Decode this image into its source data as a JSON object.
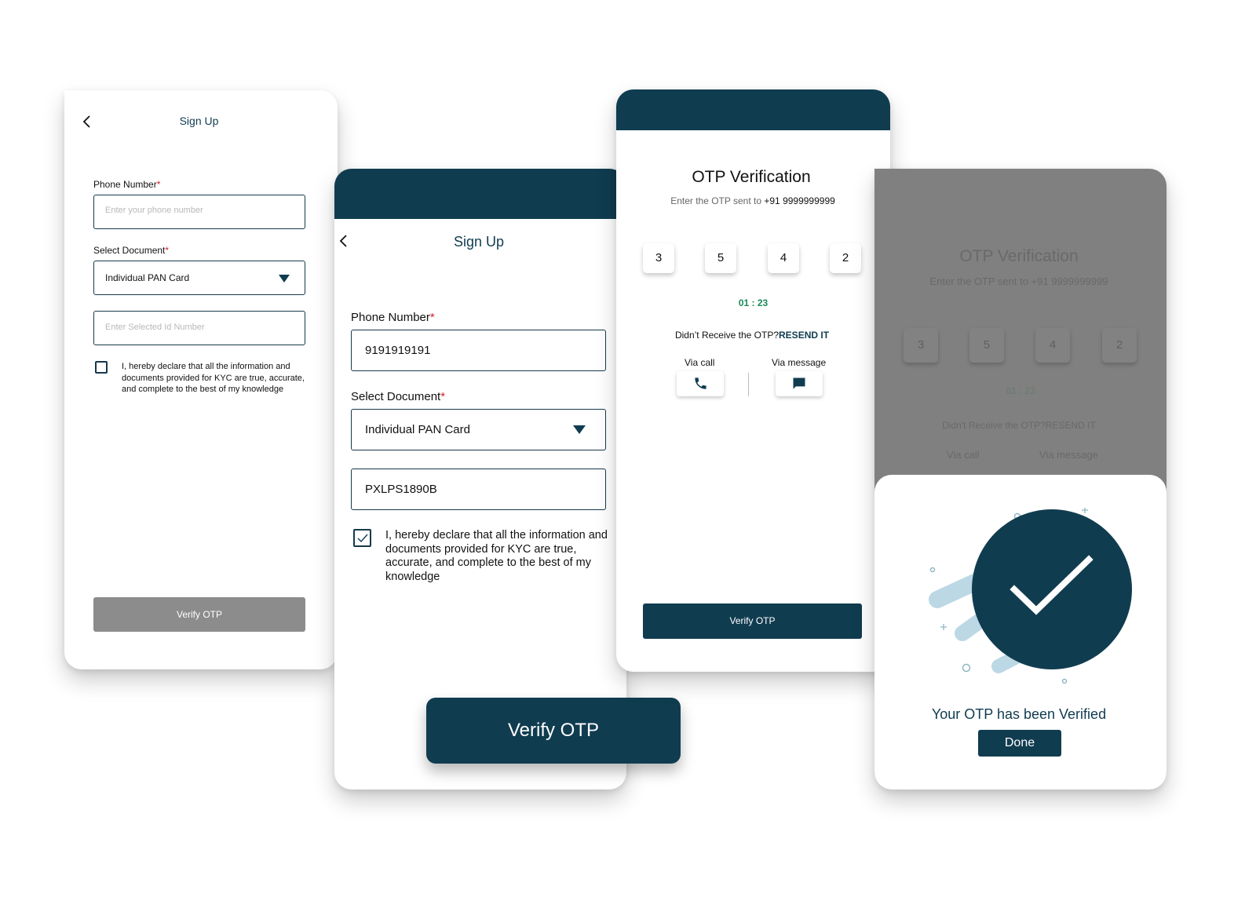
{
  "colors": {
    "primary": "#103c50",
    "disabled": "#8c8c8c",
    "timer": "#1a8a5a",
    "required": "#d21f2b",
    "overlay": "#808080"
  },
  "screen1": {
    "title": "Sign Up",
    "phone_label": "Phone Number",
    "phone_placeholder": "Enter your phone number",
    "doc_label": "Select Document",
    "doc_value": "Individual PAN Card",
    "id_placeholder": "Enter Selected Id Number",
    "declaration": "I, hereby declare that all the information and documents provided for KYC are true, accurate, and complete to the best of my knowledge",
    "verify_label": "Verify OTP"
  },
  "screen2": {
    "title": "Sign Up",
    "phone_label": "Phone Number",
    "phone_value": "9191919191",
    "doc_label": "Select Document",
    "doc_value": "Individual PAN Card",
    "id_value": "PXLPS1890B",
    "declaration": "I, hereby declare that all the information and documents provided for KYC are true, accurate, and complete to the best of my knowledge",
    "verify_label": "Verify OTP"
  },
  "screen3": {
    "title": "OTP Verification",
    "subtitle": "Enter the OTP sent to ",
    "phone": "+91 9999999999",
    "digits": [
      "3",
      "5",
      "4",
      "2"
    ],
    "timer": "01 : 23",
    "didnt_receive": "Didn’t Receive the OTP?",
    "resend": "RESEND IT",
    "via_call": "Via call",
    "via_message": "Via message",
    "verify_label": "Verify OTP"
  },
  "screen4": {
    "title": "OTP Verification",
    "subtitle": "Enter the OTP sent to ",
    "phone": "+91 9999999999",
    "digits": [
      "3",
      "5",
      "4",
      "2"
    ],
    "timer": "01 : 23",
    "didnt_receive": "Didn't Receive the OTP?",
    "resend": "RESEND IT",
    "via_call": "Via call",
    "via_message": "Via message",
    "success_text": "Your OTP has been Verified",
    "done_label": "Done"
  }
}
